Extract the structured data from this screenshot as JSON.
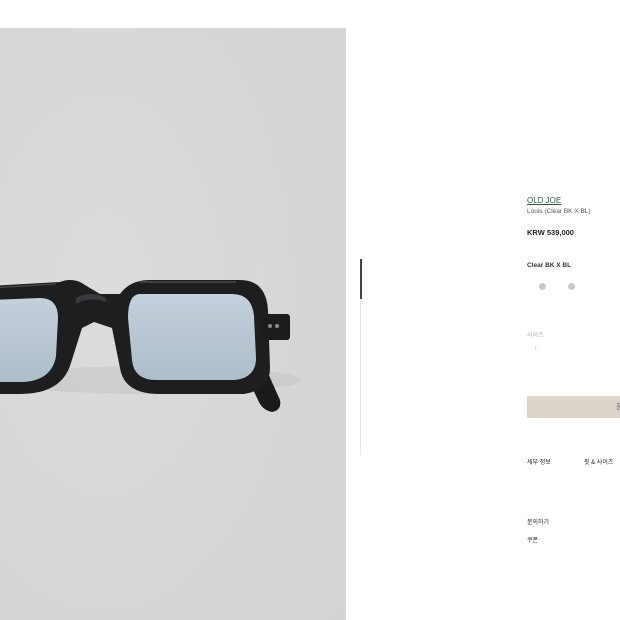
{
  "product": {
    "brand": "OLD JOE",
    "name": "Louis (Clear BK X BL)",
    "price": "KRW 539,000",
    "color": "Clear BK X BL",
    "swatches": [
      {
        "color": "#c8c8c8"
      },
      {
        "color": "#c8c8c8"
      }
    ]
  },
  "size": {
    "label": "사이즈",
    "option": "I"
  },
  "cart": {
    "label": "장"
  },
  "tabs": [
    {
      "label": "세부 정보"
    },
    {
      "label": "핏 & 사이즈"
    }
  ],
  "links": {
    "inquiry": "문의하기",
    "coupon": "쿠폰"
  },
  "photo": {
    "background": "#d9d9d9",
    "frame_color": "#1e1e20",
    "lens_tint": "#b9c7d3"
  }
}
